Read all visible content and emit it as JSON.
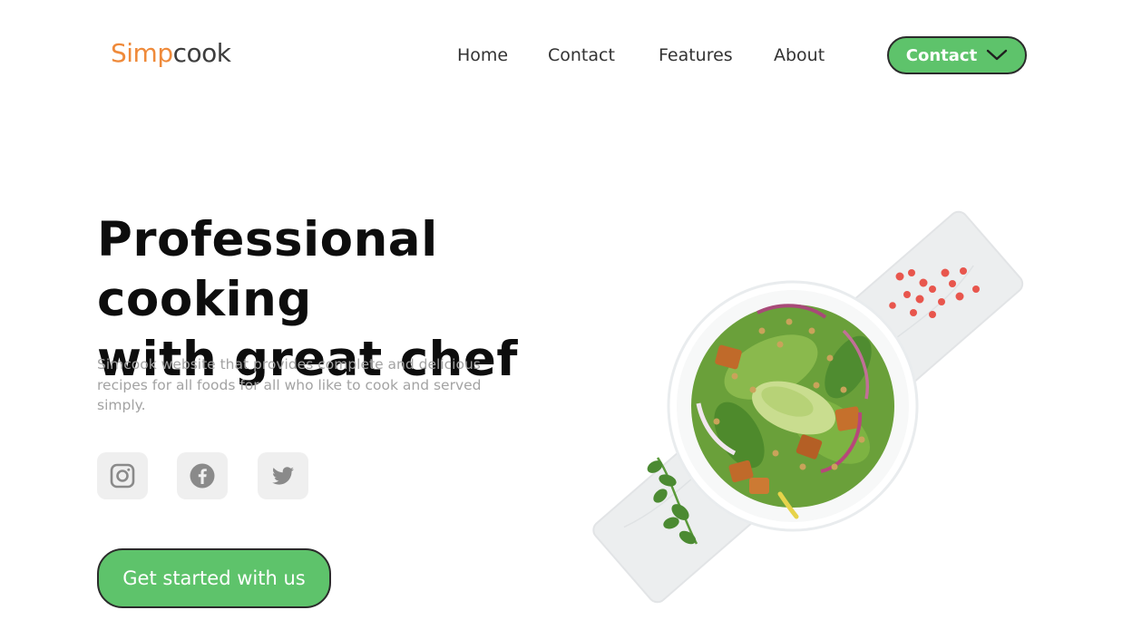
{
  "brand": {
    "part1": "Simp",
    "part2": "cook"
  },
  "nav": {
    "items": [
      {
        "label": "Home"
      },
      {
        "label": "Contact"
      },
      {
        "label": "Features"
      },
      {
        "label": "About"
      }
    ],
    "cta_label": "Contact",
    "cta_icon": "chevron-down-icon"
  },
  "hero": {
    "title_line1": "Professional cooking",
    "title_line2": "with great chef",
    "description": "Simcook website that provides complete and delicious recipes for all foods for all who like to cook and served simply.",
    "social": [
      {
        "icon": "instagram-icon"
      },
      {
        "icon": "facebook-icon"
      },
      {
        "icon": "twitter-icon"
      }
    ],
    "cta_label": "Get started with us"
  },
  "colors": {
    "accent_green": "#5ec36b",
    "brand_orange": "#ef8a3a",
    "text_dark": "#0d0d0d",
    "text_muted": "#a3a3a3",
    "social_bg": "#efefef"
  }
}
